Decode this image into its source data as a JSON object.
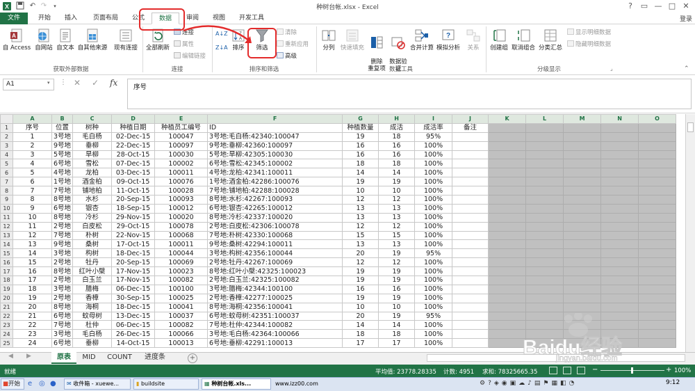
{
  "window": {
    "title": "种树台帐.xlsx - Excel",
    "controls": [
      "?",
      "▭",
      "—",
      "□",
      "✕"
    ],
    "account": "登录"
  },
  "quick_access": {
    "icons": [
      "excel-logo-icon",
      "save-icon",
      "undo-icon",
      "redo-icon",
      "customize-icon"
    ]
  },
  "tabs": [
    "文件",
    "开始",
    "插入",
    "页面布局",
    "公式",
    "数据",
    "审阅",
    "视图",
    "开发工具"
  ],
  "active_tab": "数据",
  "ribbon": {
    "get_external": {
      "buttons": [
        "自 Access",
        "自网站",
        "自文本",
        "自其他来源",
        "现有连接"
      ],
      "label": "获取外部数据"
    },
    "connections": {
      "refresh_all": "全部刷新",
      "small": [
        "连接",
        "属性",
        "编辑链接"
      ],
      "label": "连接"
    },
    "sort_filter": {
      "sort_az": "A↓Z",
      "sort_za": "Z↓A",
      "sort": "排序",
      "filter": "筛选",
      "small": [
        "清除",
        "重新应用",
        "高级"
      ],
      "label": "排序和筛选"
    },
    "data_tools": {
      "buttons": [
        "分列",
        "快速填充",
        "删除\n重复项",
        "数据验\n证",
        "合并计算",
        "模拟分析",
        "关系"
      ],
      "label": "数据工具"
    },
    "outline": {
      "buttons": [
        "创建组",
        "取消组合",
        "分类汇总"
      ],
      "small": [
        "显示明细数据",
        "隐藏明细数据"
      ],
      "label": "分级显示"
    }
  },
  "formula_bar": {
    "name_box": "A1",
    "fx": "fx",
    "content": "序号",
    "cancel": "✕",
    "enter": "✓"
  },
  "sheet": {
    "columns": [
      "A",
      "B",
      "C",
      "D",
      "E",
      "F",
      "G",
      "H",
      "I",
      "J",
      "K",
      "L",
      "M",
      "N",
      "O"
    ],
    "rows": [
      [
        "1",
        "序号",
        "位置",
        "树种",
        "种植日期",
        "种植员工编号",
        "ID",
        "种植数量",
        "成活",
        "成活率",
        "备注"
      ],
      [
        "2",
        "1",
        "3号地",
        "毛白杨",
        "02-Dec-15",
        "100047",
        "3号地:毛白杨:42340:100047",
        "19",
        "18",
        "95%",
        ""
      ],
      [
        "3",
        "2",
        "9号地",
        "垂柳",
        "22-Dec-15",
        "100097",
        "9号地:垂柳:42360:100097",
        "16",
        "16",
        "100%",
        ""
      ],
      [
        "4",
        "3",
        "5号地",
        "旱柳",
        "28-Oct-15",
        "100030",
        "5号地:旱柳:42305:100030",
        "16",
        "16",
        "100%",
        ""
      ],
      [
        "5",
        "4",
        "6号地",
        "雪松",
        "07-Dec-15",
        "100002",
        "6号地:雪松:42345:100002",
        "18",
        "18",
        "100%",
        ""
      ],
      [
        "6",
        "5",
        "4号地",
        "龙柏",
        "03-Dec-15",
        "100011",
        "4号地:龙柏:42341:100011",
        "14",
        "14",
        "100%",
        ""
      ],
      [
        "7",
        "6",
        "1号地",
        "酒金柏",
        "09-Oct-15",
        "100076",
        "1号地:酒金柏:42286:100076",
        "19",
        "19",
        "100%",
        ""
      ],
      [
        "8",
        "7",
        "7号地",
        "铺地柏",
        "11-Oct-15",
        "100028",
        "7号地:铺地柏:42288:100028",
        "10",
        "10",
        "100%",
        ""
      ],
      [
        "9",
        "8",
        "8号地",
        "水杉",
        "20-Sep-15",
        "100093",
        "8号地:水杉:42267:100093",
        "12",
        "12",
        "100%",
        ""
      ],
      [
        "10",
        "9",
        "6号地",
        "银杏",
        "18-Sep-15",
        "100012",
        "6号地:银杏:42265:100012",
        "13",
        "13",
        "100%",
        ""
      ],
      [
        "11",
        "10",
        "8号地",
        "冷杉",
        "29-Nov-15",
        "100020",
        "8号地:冷杉:42337:100020",
        "13",
        "13",
        "100%",
        ""
      ],
      [
        "12",
        "11",
        "2号地",
        "白皮松",
        "29-Oct-15",
        "100078",
        "2号地:白皮松:42306:100078",
        "12",
        "12",
        "100%",
        ""
      ],
      [
        "13",
        "12",
        "7号地",
        "朴树",
        "22-Nov-15",
        "100068",
        "7号地:朴树:42330:100068",
        "15",
        "15",
        "100%",
        ""
      ],
      [
        "14",
        "13",
        "9号地",
        "桑树",
        "17-Oct-15",
        "100011",
        "9号地:桑树:42294:100011",
        "13",
        "13",
        "100%",
        ""
      ],
      [
        "15",
        "14",
        "3号地",
        "构树",
        "18-Dec-15",
        "100044",
        "3号地:构树:42356:100044",
        "20",
        "19",
        "95%",
        ""
      ],
      [
        "16",
        "15",
        "2号地",
        "牡丹",
        "20-Sep-15",
        "100069",
        "2号地:牡丹:42267:100069",
        "12",
        "12",
        "100%",
        ""
      ],
      [
        "17",
        "16",
        "8号地",
        "红叶小檗",
        "17-Nov-15",
        "100023",
        "8号地:红叶小檗:42325:100023",
        "19",
        "19",
        "100%",
        ""
      ],
      [
        "18",
        "17",
        "2号地",
        "白玉兰",
        "17-Nov-15",
        "100082",
        "2号地:白玉兰:42325:100082",
        "19",
        "19",
        "100%",
        ""
      ],
      [
        "19",
        "18",
        "3号地",
        "腊梅",
        "06-Dec-15",
        "100100",
        "3号地:腊梅:42344:100100",
        "16",
        "16",
        "100%",
        ""
      ],
      [
        "20",
        "19",
        "2号地",
        "香樟",
        "30-Sep-15",
        "100025",
        "2号地:香樟:42277:100025",
        "19",
        "19",
        "100%",
        ""
      ],
      [
        "21",
        "20",
        "8号地",
        "海桐",
        "18-Dec-15",
        "100041",
        "8号地:海桐:42356:100041",
        "10",
        "10",
        "100%",
        ""
      ],
      [
        "22",
        "21",
        "6号地",
        "蚊母树",
        "13-Dec-15",
        "100037",
        "6号地:蚊母树:42351:100037",
        "20",
        "19",
        "95%",
        ""
      ],
      [
        "23",
        "22",
        "7号地",
        "杜仲",
        "06-Dec-15",
        "100082",
        "7号地:杜仲:42344:100082",
        "14",
        "14",
        "100%",
        ""
      ],
      [
        "24",
        "23",
        "3号地",
        "毛白杨",
        "26-Dec-15",
        "100066",
        "3号地:毛白杨:42364:100066",
        "18",
        "18",
        "100%",
        ""
      ],
      [
        "25",
        "24",
        "6号地",
        "垂柳",
        "14-Oct-15",
        "100013",
        "6号地:垂柳:42291:100013",
        "17",
        "17",
        "100%",
        ""
      ]
    ]
  },
  "sheet_tabs": [
    "原表",
    "MID",
    "COUNT",
    "进度条"
  ],
  "status": {
    "ready": "就绪",
    "average": "平均值: 23778.28335",
    "count": "计数: 4951",
    "sum": "求和: 78325665.35",
    "zoom": "100%"
  },
  "taskbar": {
    "start": "开始",
    "items": [
      "收件箱 - xuewe...",
      "buildsite",
      "种树台帐.xls...",
      "www.izz00.com"
    ],
    "clock": "9:12"
  },
  "watermark": {
    "brand": "Baidu经验",
    "url": "jingyan.baidu.com"
  },
  "colors": {
    "accent": "#217346",
    "highlight": "#e32b2b",
    "taskbar": "#dbe4f2"
  }
}
